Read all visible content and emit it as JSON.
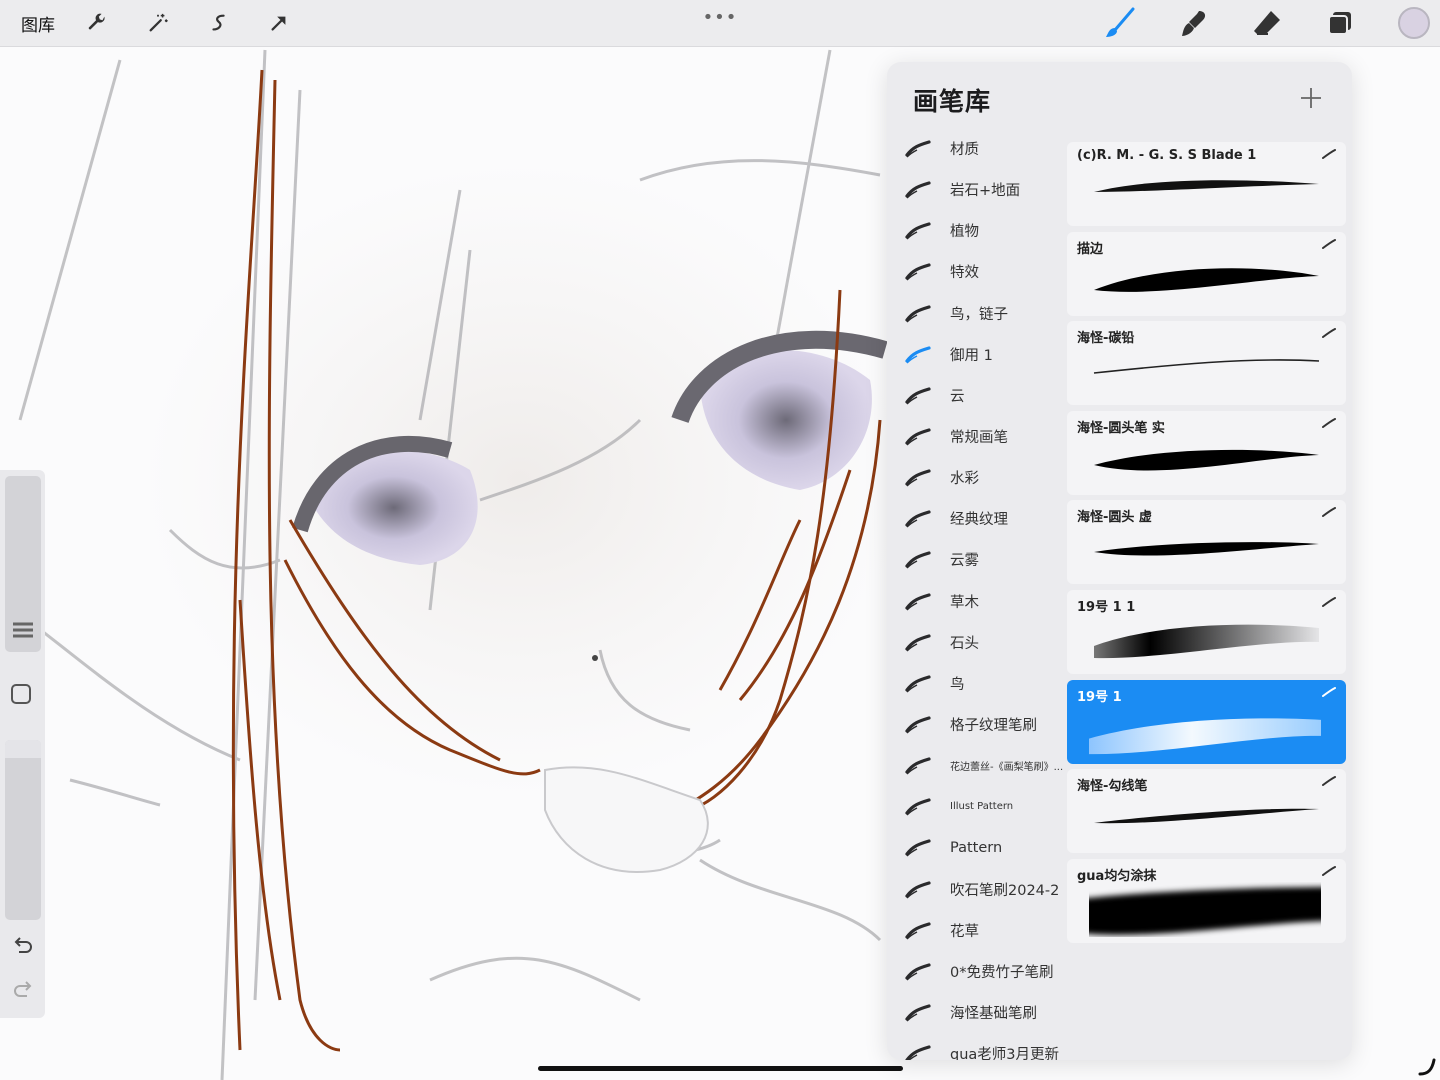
{
  "toolbar": {
    "gallery_label": "图库",
    "more_label": "•••",
    "left_tools": [
      "wrench-icon",
      "magic-wand-icon",
      "selection-icon",
      "move-arrow-icon"
    ],
    "right_tools": [
      "brush-icon",
      "smudge-icon",
      "eraser-icon",
      "layers-icon"
    ],
    "active_tool": "brush",
    "current_color": "#d9d2e2",
    "accent": "#1b8cf3"
  },
  "panel": {
    "title": "画笔库",
    "add_label": "+"
  },
  "brush_sets": [
    {
      "label": "材质",
      "active": false
    },
    {
      "label": "岩石+地面",
      "active": false
    },
    {
      "label": "植物",
      "active": false
    },
    {
      "label": "特效",
      "active": false
    },
    {
      "label": "鸟，链子",
      "active": false
    },
    {
      "label": "御用 1",
      "active": true
    },
    {
      "label": "云",
      "active": false
    },
    {
      "label": "常规画笔",
      "active": false
    },
    {
      "label": "水彩",
      "active": false
    },
    {
      "label": "经典纹理",
      "active": false
    },
    {
      "label": "云雾",
      "active": false
    },
    {
      "label": "草木",
      "active": false
    },
    {
      "label": "石头",
      "active": false
    },
    {
      "label": "鸟",
      "active": false
    },
    {
      "label": "格子纹理笔刷",
      "active": false
    },
    {
      "label": "花边蕾丝-《画梨笔刷》...",
      "active": false
    },
    {
      "label": "Illust Pattern",
      "active": false
    },
    {
      "label": "Pattern",
      "active": false
    },
    {
      "label": "吹石笔刷2024-2",
      "active": false
    },
    {
      "label": "花草",
      "active": false
    },
    {
      "label": "0*免费竹子笔刷",
      "active": false
    },
    {
      "label": "海怪基础笔刷",
      "active": false
    },
    {
      "label": "qua老师3月更新",
      "active": false
    }
  ],
  "brushes": [
    {
      "name": "(c)R. M. - G. S. S Blade 1",
      "selected": false
    },
    {
      "name": "描边",
      "selected": false
    },
    {
      "name": "海怪-碳铅",
      "selected": false
    },
    {
      "name": "海怪-圆头笔 实",
      "selected": false
    },
    {
      "name": "海怪-圆头 虚",
      "selected": false
    },
    {
      "name": "19号 1 1",
      "selected": false
    },
    {
      "name": "19号 1",
      "selected": true
    },
    {
      "name": "海怪-勾线笔",
      "selected": false
    },
    {
      "name": "gua均匀涂抹",
      "selected": false
    }
  ]
}
